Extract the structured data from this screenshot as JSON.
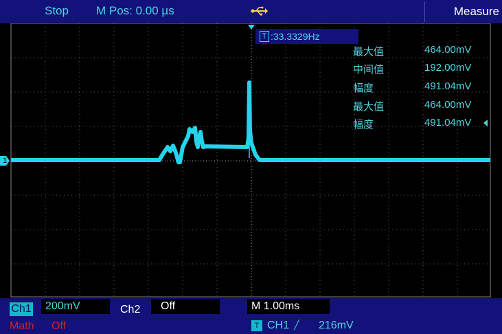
{
  "header": {
    "status": "Stop",
    "mpos": "M Pos: 0.00 µs",
    "measure_label": "Measure"
  },
  "trigger": {
    "badge": "T",
    "frequency": ":33.3329Hz"
  },
  "measurements": [
    {
      "label": "最大值",
      "value": "464.00mV"
    },
    {
      "label": "中间值",
      "value": "192.00mV"
    },
    {
      "label": "幅度",
      "value": "491.04mV"
    },
    {
      "label": "最大值",
      "value": "464.00mV"
    },
    {
      "label": "幅度",
      "value": "491.04mV"
    }
  ],
  "footer": {
    "ch1_label": "Ch1",
    "ch1_scale": "200mV",
    "ch2_label": "Ch2",
    "ch2_scale": "Off",
    "math_label": "Math",
    "math_scale": "Off",
    "timebase": "M 1.00ms",
    "trig_badge": "T",
    "trig_source": "CH1",
    "trig_edge_symbol": "╱",
    "trig_level": "216mV"
  },
  "ground_marker": "1",
  "colors": {
    "trace": "#26d3ec",
    "background": "#000000",
    "bar": "#12127a",
    "text_accent": "#4fd6e0",
    "math": "#d8201c"
  },
  "icons": [
    "usb-icon",
    "trigger-position-marker-icon",
    "ground-level-marker-icon",
    "selected-measurement-arrow-icon",
    "rising-edge-icon"
  ]
}
